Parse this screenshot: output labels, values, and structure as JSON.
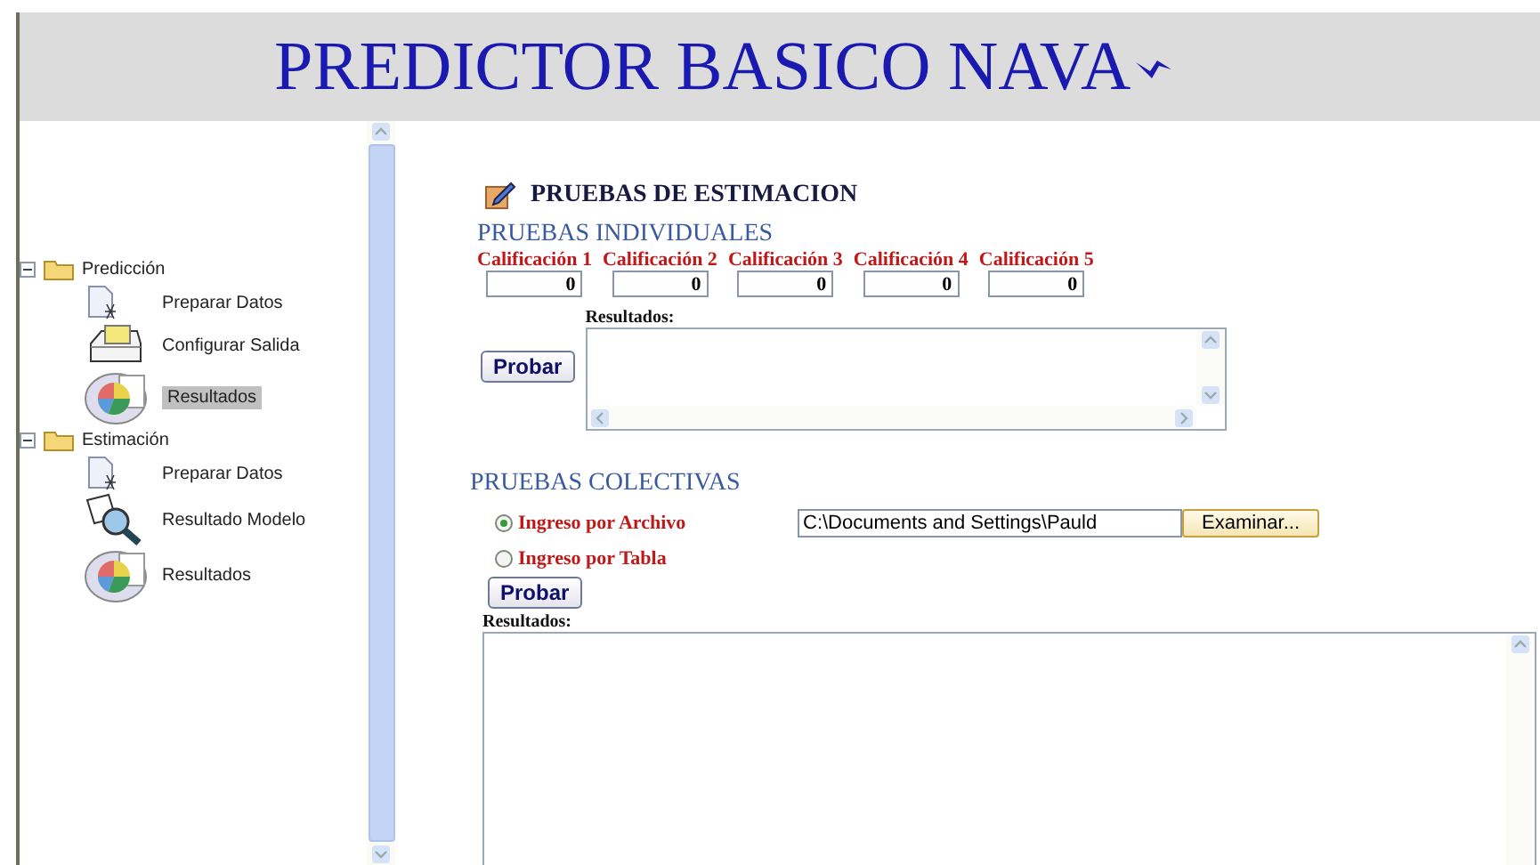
{
  "header": {
    "title": "PREDICTOR BASICO NAVA"
  },
  "tree": [
    {
      "label": "Predicción",
      "expanded": true,
      "children": [
        {
          "label": "Preparar Datos",
          "kind": "document",
          "selected": false
        },
        {
          "label": "Configurar Salida",
          "kind": "printer",
          "selected": false
        },
        {
          "label": "Resultados",
          "kind": "chart",
          "selected": true
        }
      ]
    },
    {
      "label": "Estimación",
      "expanded": true,
      "children": [
        {
          "label": "Preparar Datos",
          "kind": "document",
          "selected": false
        },
        {
          "label": "Resultado Modelo",
          "kind": "magnifier",
          "selected": false
        },
        {
          "label": "Resultados",
          "kind": "chart",
          "selected": false
        }
      ]
    }
  ],
  "main": {
    "title": "PRUEBAS DE ESTIMACION",
    "individual": {
      "title": "PRUEBAS INDIVIDUALES",
      "fields": [
        {
          "label": "Calificación 1",
          "value": "0"
        },
        {
          "label": "Calificación 2",
          "value": "0"
        },
        {
          "label": "Calificación 3",
          "value": "0"
        },
        {
          "label": "Calificación 4",
          "value": "0"
        },
        {
          "label": "Calificación 5",
          "value": "0"
        }
      ],
      "results_label": "Resultados:",
      "button": "Probar"
    },
    "collective": {
      "title": "PRUEBAS COLECTIVAS",
      "options": [
        {
          "label": "Ingreso por Archivo",
          "selected": true
        },
        {
          "label": "Ingreso por Tabla",
          "selected": false
        }
      ],
      "file_path": "C:\\Documents and Settings\\Pauld",
      "browse_button": "Examinar...",
      "button": "Probar",
      "results_label": "Resultados:"
    }
  }
}
